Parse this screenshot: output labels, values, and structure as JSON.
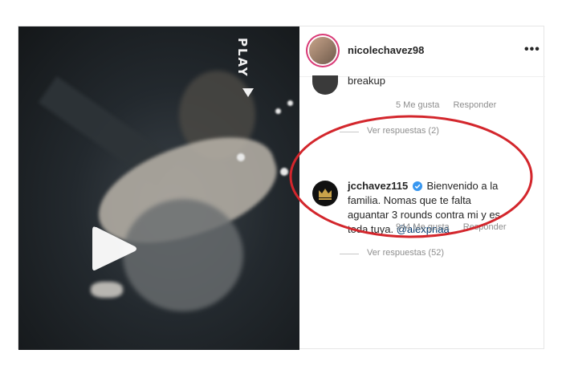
{
  "post": {
    "username": "nicolechavez98",
    "more_icon": "more-horizontal-icon"
  },
  "video": {
    "overlay_text": "PLAY",
    "play_icon": "play-icon"
  },
  "comments": [
    {
      "text": "breakup",
      "likes": "5 Me gusta",
      "reply": "Responder",
      "view_replies": "Ver respuestas (2)"
    },
    {
      "username": "jcchavez115",
      "verified_icon": "verified-badge-icon",
      "text": "Bienvenido a la familia. Nomas que te falta aguantar 3 rounds contra mi y es toda tuya.",
      "mention": "@alexpnaa",
      "likes": "944 Me gusta",
      "reply": "Responder",
      "view_replies": "Ver respuestas (52)"
    }
  ],
  "colors": {
    "highlight_oval": "#d3262c",
    "verified": "#3897f0",
    "gold_crown": "#c9a24a"
  }
}
